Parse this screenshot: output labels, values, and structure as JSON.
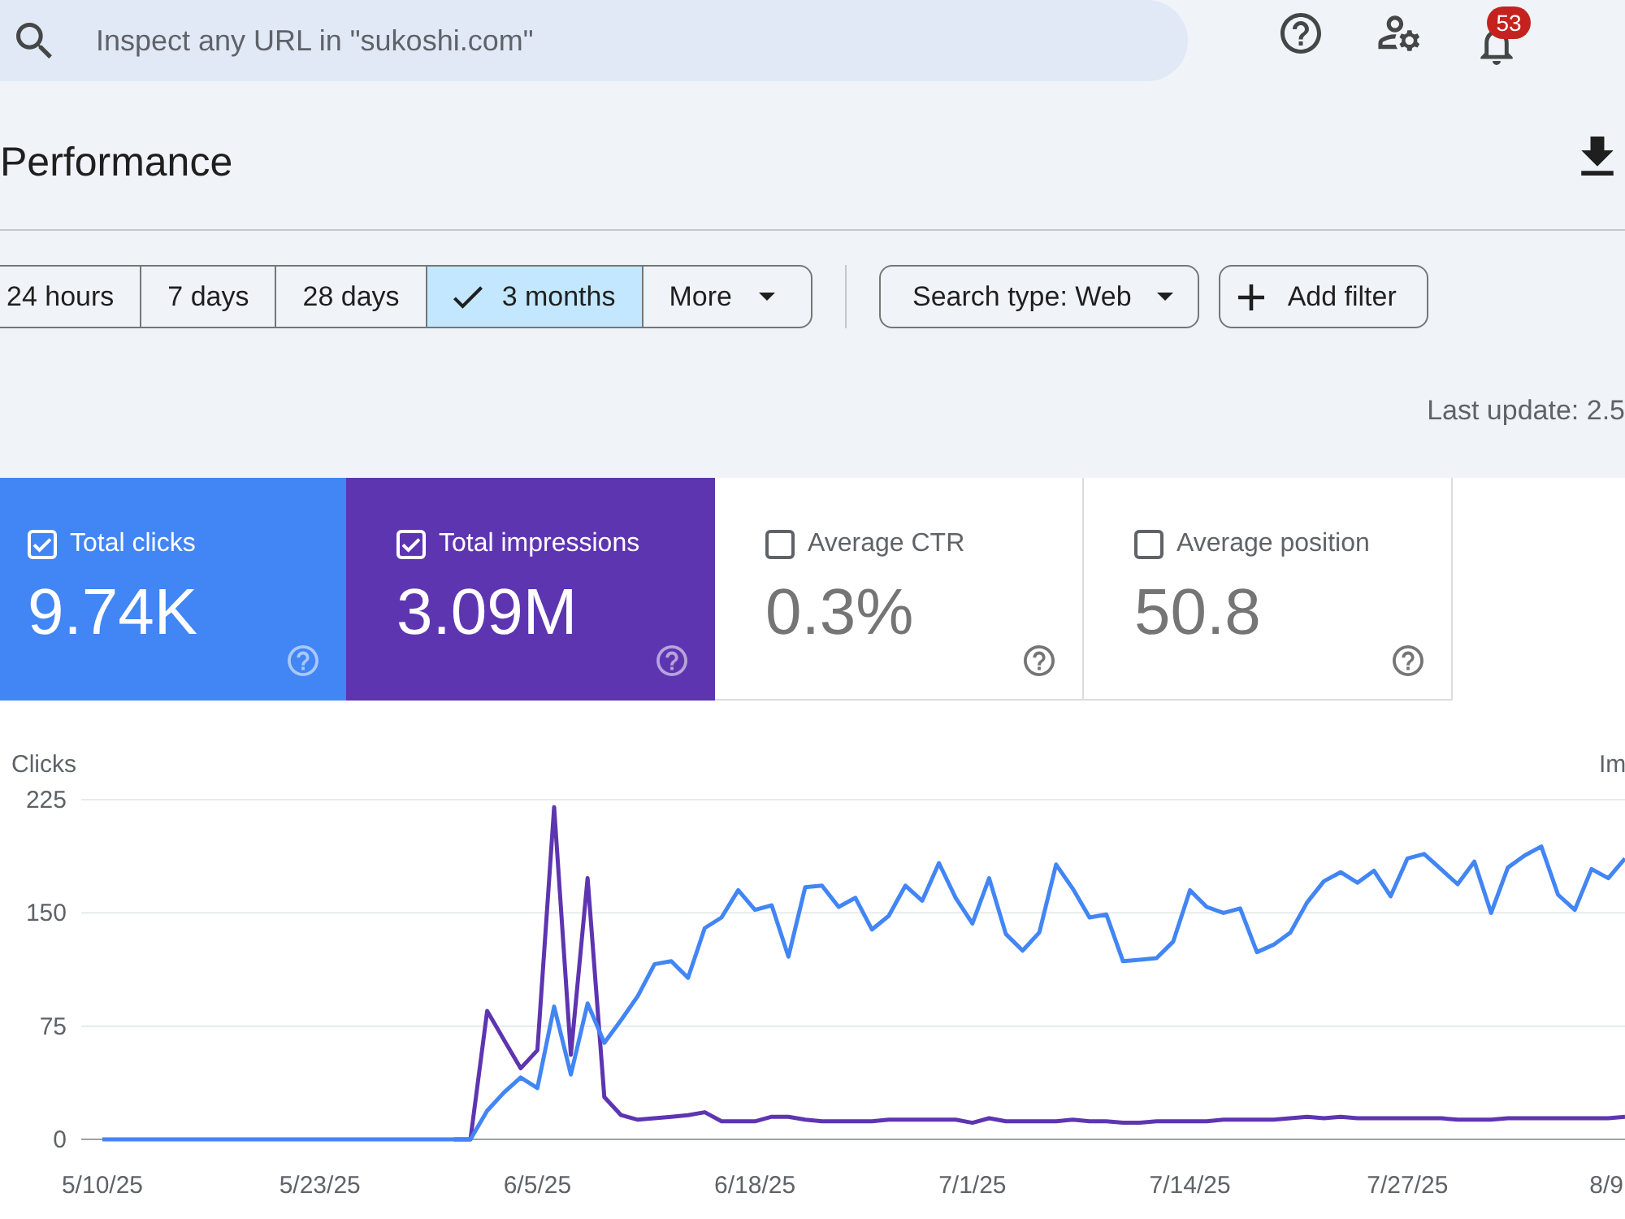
{
  "search": {
    "placeholder": "Inspect any URL in \"sukoshi.com\""
  },
  "notifications": {
    "badge": "53"
  },
  "page": {
    "title": "Performance",
    "last_update": "Last update: 2.5"
  },
  "date_ranges": [
    {
      "kind": "range",
      "label": "24 hours",
      "selected": false
    },
    {
      "kind": "range",
      "label": "7 days",
      "selected": false
    },
    {
      "kind": "range",
      "label": "28 days",
      "selected": false
    },
    {
      "kind": "range",
      "label": "3 months",
      "selected": true
    },
    {
      "kind": "menu",
      "label": "More",
      "selected": false
    }
  ],
  "filters": [
    {
      "kind": "dropdown",
      "label": "Search type: Web"
    },
    {
      "kind": "add",
      "label": "Add filter"
    }
  ],
  "metrics": [
    {
      "label": "Total clicks",
      "value": "9.74K",
      "checked": true,
      "color": "#4285f4"
    },
    {
      "label": "Total impressions",
      "value": "3.09M",
      "checked": true,
      "color": "#5e35b1"
    },
    {
      "label": "Average CTR",
      "value": "0.3%",
      "checked": false
    },
    {
      "label": "Average position",
      "value": "50.8",
      "checked": false
    }
  ],
  "chart": {
    "right_axis_label": "Im",
    "cut_x_label": "8/9",
    "chart_data": {
      "type": "line",
      "ylabel": "Clicks",
      "categories": [
        "5/10/25",
        null,
        null,
        null,
        null,
        null,
        null,
        null,
        null,
        null,
        null,
        null,
        null,
        "5/23/25",
        null,
        null,
        null,
        null,
        null,
        null,
        null,
        null,
        null,
        null,
        null,
        null,
        "6/5/25",
        null,
        null,
        null,
        null,
        null,
        null,
        null,
        null,
        null,
        null,
        null,
        null,
        "6/18/25",
        null,
        null,
        null,
        null,
        null,
        null,
        null,
        null,
        null,
        null,
        null,
        null,
        "7/1/25",
        null,
        null,
        null,
        null,
        null,
        null,
        null,
        null,
        null,
        null,
        null,
        null,
        "7/14/25",
        null,
        null,
        null,
        null,
        null,
        null,
        null,
        null,
        null,
        null,
        null,
        null,
        "7/27/25",
        null,
        null,
        null,
        null,
        null,
        null,
        null,
        null,
        null,
        null,
        null,
        null,
        null
      ],
      "ylim": [
        0,
        225
      ],
      "yticks": [
        0,
        75,
        150,
        225
      ],
      "series": [
        {
          "color": "#4285f4",
          "values": [
            0,
            0,
            0,
            0,
            0,
            0,
            0,
            0,
            0,
            0,
            0,
            0,
            0,
            0,
            0,
            0,
            0,
            0,
            0,
            0,
            0,
            0,
            0,
            19,
            31,
            41,
            34,
            88,
            43,
            90,
            64,
            79,
            95,
            116,
            118,
            107,
            140,
            147,
            165,
            152,
            155,
            121,
            167,
            168,
            154,
            160,
            139,
            148,
            168,
            158,
            183,
            160,
            143,
            173,
            136,
            125,
            137,
            182,
            166,
            147,
            149,
            118,
            119,
            120,
            131,
            165,
            154,
            150,
            153,
            124,
            129,
            137,
            157,
            171,
            177,
            170,
            178,
            161,
            186,
            189,
            179,
            169,
            184,
            150,
            180,
            188,
            194,
            162,
            152,
            179,
            173,
            186
          ]
        },
        {
          "color": "#5e35b1",
          "values": [
            null,
            null,
            null,
            null,
            null,
            null,
            null,
            null,
            null,
            null,
            null,
            null,
            null,
            null,
            null,
            null,
            null,
            null,
            null,
            null,
            null,
            0,
            0,
            85,
            66,
            47,
            59,
            220,
            56,
            173,
            28,
            16,
            13,
            14,
            15,
            16,
            18,
            12,
            12,
            12,
            15,
            15,
            13,
            12,
            12,
            12,
            12,
            13,
            13,
            13,
            13,
            13,
            11,
            14,
            12,
            12,
            12,
            12,
            13,
            12,
            12,
            11,
            11,
            12,
            12,
            12,
            12,
            13,
            13,
            13,
            13,
            14,
            15,
            14,
            15,
            14,
            14,
            14,
            14,
            14,
            14,
            13,
            13,
            13,
            14,
            14,
            14,
            14,
            14,
            14,
            14,
            15
          ]
        }
      ]
    }
  }
}
